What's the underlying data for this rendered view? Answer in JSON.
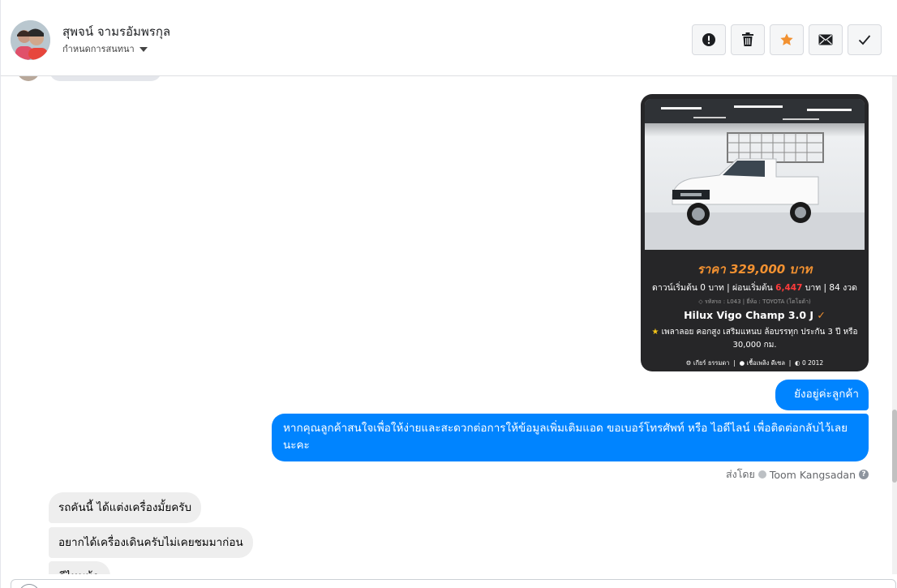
{
  "header": {
    "contact_name": "สุพจน์ จามรอัมพรกุล",
    "assign_label": "กำหนดการสนทนา",
    "actions": [
      {
        "name": "report",
        "icon": "exclamation-circle-icon"
      },
      {
        "name": "delete",
        "icon": "trash-icon"
      },
      {
        "name": "star",
        "icon": "star-icon"
      },
      {
        "name": "mark-unread",
        "icon": "envelope-icon"
      },
      {
        "name": "mark-done",
        "icon": "checkmark-icon"
      }
    ]
  },
  "colors": {
    "accent": "#0084ff",
    "price": "#f29131",
    "card_bg": "#262628",
    "star": "#f29131"
  },
  "car_card": {
    "price": "ราคา 329,000 บาท",
    "down_payment_a": "ดาวน์เริ่มต้น 0 บาท | ผ่อนเริ่มต้น",
    "monthly_amount": "6,447",
    "down_payment_b": "บาท | 84 งวด",
    "code_brand": "รหัสรถ : L043 | ยี่ห้อ : TOYOTA (โตโยต้า)",
    "model": "Hilux Vigo Champ 3.0 J",
    "desc": "เพลาลอย คอกสูง เสริมแหนบ ล้อบรรทุก ประกัน 3 ปี หรือ 30,000 กม.",
    "spec_gear": "เกียร์ ธรรมดา",
    "spec_fuel": "เชื้อเพลิง ดีเซล",
    "spec_year": "0 2012"
  },
  "messages": {
    "out_1": "ยังอยู่ค่ะลูกค้า",
    "out_2": "หากคุณลูกค้าสนใจเพื่อให้ง่ายและสะดวกต่อการให้ข้อมูลเพิ่มเติมแอด ขอเบอร์โทรศัพท์ หรือ ไอดีไลน์ เพื่อติดต่อกลับไว้เลยนะคะ",
    "sent_by_label": "ส่งโดย",
    "sent_by_name": "Toom Kangsadan",
    "in_1": "รถคันนี้ ได้แต่งเครื่องมั้ยครับ",
    "in_2": "อยากได้เครื่องเดินครับไม่เคยชมมาก่อน",
    "in_3": "ดีไหมน้า"
  }
}
